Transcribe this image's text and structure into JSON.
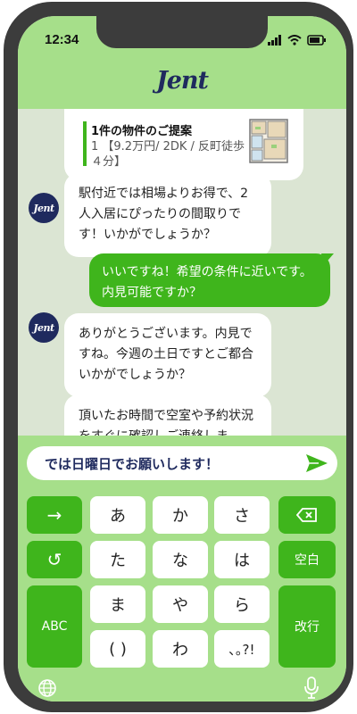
{
  "status_bar": {
    "time": "12:34"
  },
  "app": {
    "logo": "Jent"
  },
  "avatar_label": "Jent",
  "property_card": {
    "title": "1件の物件のご提案",
    "detail": "1 【9.2万円/ 2DK / 反町徒歩４分】"
  },
  "messages": [
    {
      "from": "agent",
      "text": "駅付近では相場よりお得で、2人入居にぴったりの間取りです！いかがでしょうか？"
    },
    {
      "from": "user",
      "text": "いいですね！希望の条件に近いです。内見可能ですか？"
    },
    {
      "from": "agent",
      "text": "ありがとうございます。内見ですね。今週の土日ですとご都合いかがでしょうか？"
    },
    {
      "from": "agent",
      "text": "頂いたお時間で空室や予約状況をすぐに確認しご連絡しま"
    }
  ],
  "input": {
    "value": "では日曜日でお願いします！"
  },
  "keyboard": {
    "keys": {
      "next": "→",
      "a": "あ",
      "ka": "か",
      "sa": "さ",
      "undo": "↺",
      "ta": "た",
      "na": "な",
      "ha": "は",
      "space": "空白",
      "abc": "ABC",
      "ma": "ま",
      "ya": "や",
      "ra": "ら",
      "enter": "改行",
      "paren": "( )",
      "wa": "わ",
      "punct": "､｡?!"
    }
  },
  "colors": {
    "accent": "#3fb51c",
    "header": "#a6df8a",
    "navy": "#1f2a5e",
    "bg": "#dbe5d3"
  }
}
